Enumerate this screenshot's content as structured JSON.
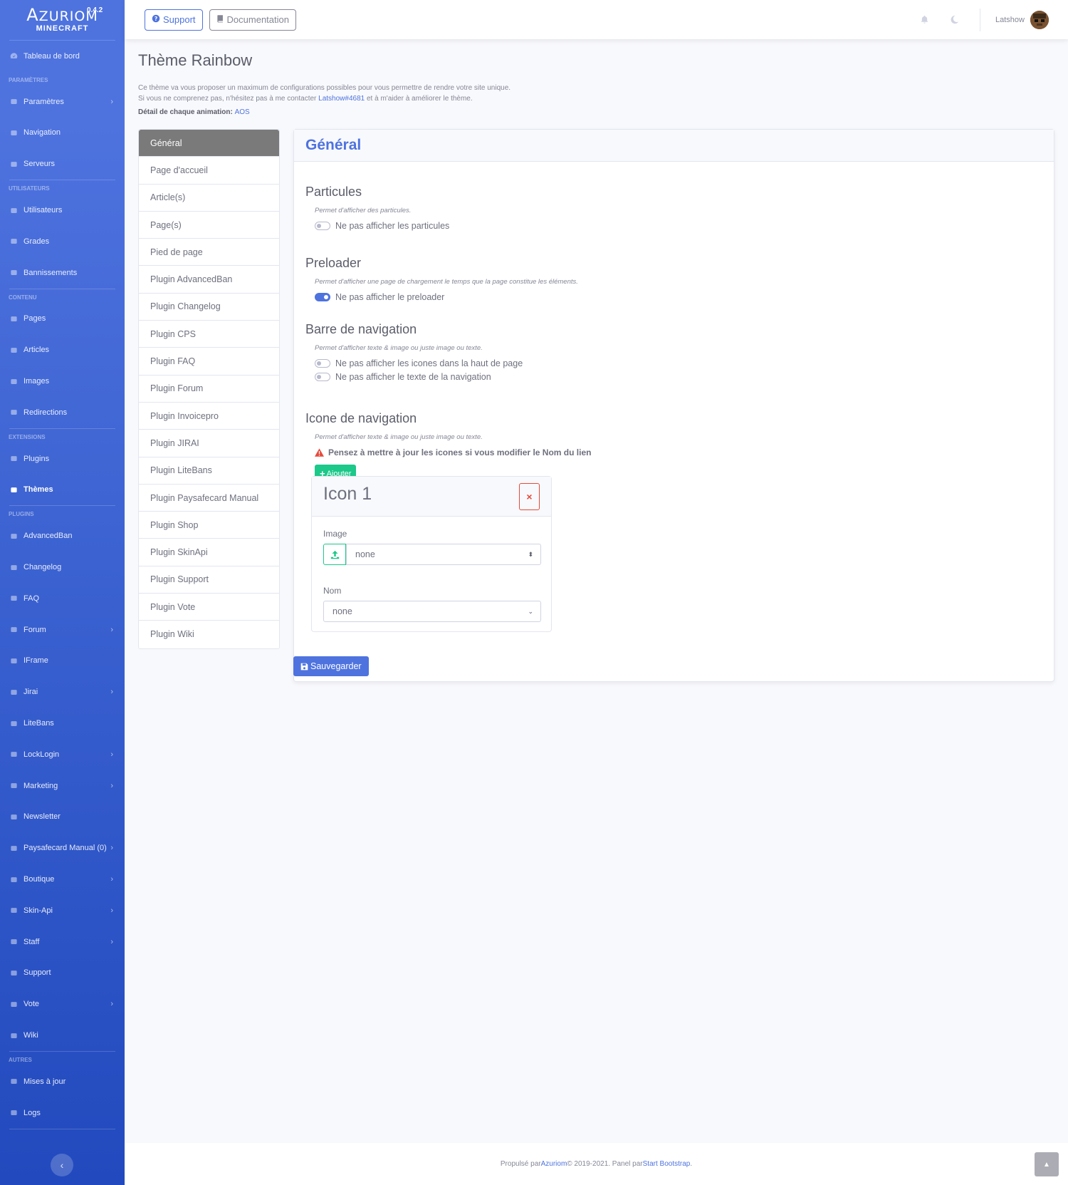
{
  "brand": {
    "name_first": "A",
    "name_rest": "ZURIOM",
    "version": "0.4.2",
    "sub": "MINECRAFT"
  },
  "sidebar": {
    "dashboard": "Tableau de bord",
    "headings": {
      "params": "PARAMÈTRES",
      "users": "UTILISATEURS",
      "content": "CONTENU",
      "extensions": "EXTENSIONS",
      "plugins": "PLUGINS",
      "others": "AUTRES"
    },
    "items": [
      {
        "label": "Paramètres",
        "icon": "cogs-icon",
        "chevron": true
      },
      {
        "label": "Navigation",
        "icon": "bars-icon",
        "chevron": false
      },
      {
        "label": "Serveurs",
        "icon": "server-icon",
        "chevron": false
      },
      {
        "label": "Utilisateurs",
        "icon": "users-icon",
        "chevron": false
      },
      {
        "label": "Grades",
        "icon": "user-tag-icon",
        "chevron": false
      },
      {
        "label": "Bannissements",
        "icon": "user-times-icon",
        "chevron": false
      },
      {
        "label": "Pages",
        "icon": "file-icon",
        "chevron": false
      },
      {
        "label": "Articles",
        "icon": "newspaper-icon",
        "chevron": false
      },
      {
        "label": "Images",
        "icon": "image-icon",
        "chevron": false
      },
      {
        "label": "Redirections",
        "icon": "directions-icon",
        "chevron": false
      },
      {
        "label": "Plugins",
        "icon": "puzzle-icon",
        "chevron": false
      },
      {
        "label": "Thèmes",
        "icon": "brush-icon",
        "chevron": false,
        "active": true
      },
      {
        "label": "AdvancedBan",
        "icon": "gavel-icon",
        "chevron": false
      },
      {
        "label": "Changelog",
        "icon": "clipboard-icon",
        "chevron": false
      },
      {
        "label": "FAQ",
        "icon": "question-circle-icon",
        "chevron": false
      },
      {
        "label": "Forum",
        "icon": "comments-icon",
        "chevron": true
      },
      {
        "label": "IFrame",
        "icon": "window-icon",
        "chevron": false
      },
      {
        "label": "Jirai",
        "icon": "tags-icon",
        "chevron": true
      },
      {
        "label": "LiteBans",
        "icon": "hammer-icon",
        "chevron": false
      },
      {
        "label": "LockLogin",
        "icon": "file-lock-icon",
        "chevron": true
      },
      {
        "label": "Marketing",
        "icon": "chart-icon",
        "chevron": true
      },
      {
        "label": "Newsletter",
        "icon": "envelope-icon",
        "chevron": false
      },
      {
        "label": "Paysafecard Manual (0)",
        "icon": "chart-bar-icon",
        "chevron": true
      },
      {
        "label": "Boutique",
        "icon": "cart-icon",
        "chevron": true
      },
      {
        "label": "Skin-Api",
        "icon": "user-circle-icon",
        "chevron": true
      },
      {
        "label": "Staff",
        "icon": "user-tie-icon",
        "chevron": true
      },
      {
        "label": "Support",
        "icon": "question-icon",
        "chevron": false
      },
      {
        "label": "Vote",
        "icon": "thumbs-up-icon",
        "chevron": true
      },
      {
        "label": "Wiki",
        "icon": "book-icon",
        "chevron": false
      },
      {
        "label": "Mises à jour",
        "icon": "cloud-download-icon",
        "chevron": false
      },
      {
        "label": "Logs",
        "icon": "history-icon",
        "chevron": false
      }
    ]
  },
  "topbar": {
    "support": "Support",
    "documentation": "Documentation",
    "username": "Latshow"
  },
  "page": {
    "title": "Thème Rainbow",
    "intro_line1": "Ce thème va vous proposer un maximum de configurations possibles pour vous permettre de rendre votre site unique.",
    "intro_line2_a": "Si vous ne comprenez pas, n'hésitez pas à me contacter ",
    "intro_link": "Latshow#4681",
    "intro_line2_b": " et à m'aider à améliorer le thème.",
    "anim_label": "Détail de chaque animation: ",
    "anim_link": "AOS"
  },
  "tabs": [
    "Général",
    "Page d'accueil",
    "Article(s)",
    "Page(s)",
    "Pied de page",
    "Plugin AdvancedBan",
    "Plugin Changelog",
    "Plugin CPS",
    "Plugin FAQ",
    "Plugin Forum",
    "Plugin Invoicepro",
    "Plugin JIRAI",
    "Plugin LiteBans",
    "Plugin Paysafecard Manual",
    "Plugin Shop",
    "Plugin SkinApi",
    "Plugin Support",
    "Plugin Vote",
    "Plugin Wiki"
  ],
  "general": {
    "title": "Général",
    "particles": {
      "title": "Particules",
      "desc": "Permet d'afficher des particules.",
      "switch": "Ne pas afficher les particules",
      "on": false
    },
    "preloader": {
      "title": "Preloader",
      "desc": "Permet d'afficher une page de chargement le temps que la page constitue les éléments.",
      "switch": "Ne pas afficher le preloader",
      "on": true
    },
    "navbar": {
      "title": "Barre de navigation",
      "desc": "Permet d'afficher texte & image ou juste image ou texte.",
      "switch1": "Ne pas afficher les icones dans la haut de page",
      "switch2": "Ne pas afficher le texte de la navigation",
      "on1": false,
      "on2": false
    },
    "navicon": {
      "title": "Icone de navigation",
      "desc": "Permet d'afficher texte & image ou juste image ou texte.",
      "warning": "Pensez à mettre à jour les icones si vous modifier le Nom du lien",
      "add": "Ajouter",
      "card_title": "Icon 1",
      "image_label": "Image",
      "image_value": "none",
      "name_label": "Nom",
      "name_value": "none"
    },
    "save": "Sauvegarder"
  },
  "footer": {
    "prefix": "Propulsé par ",
    "azuriom": "Azuriom",
    "middle": " © 2019-2021. Panel par ",
    "sb": "Start Bootstrap",
    "suffix": "."
  },
  "colors": {
    "primary": "#4e73df",
    "success": "#1cc88a",
    "danger": "#e74a3b"
  }
}
